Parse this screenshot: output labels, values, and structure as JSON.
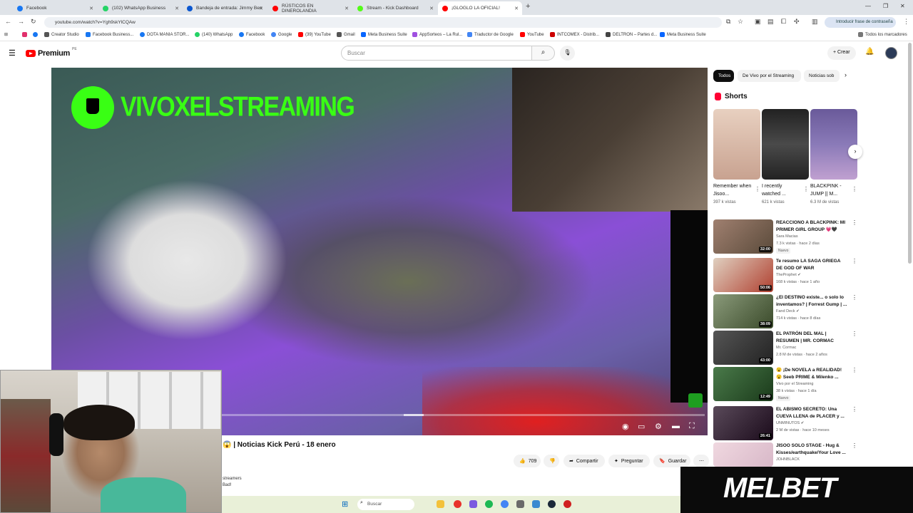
{
  "browser": {
    "tabs": [
      {
        "label": "Facebook",
        "color": "#1877f2"
      },
      {
        "label": "(102) WhatsApp Business",
        "color": "#25d366"
      },
      {
        "label": "Bandeja de entrada: Jimmy Ben",
        "color": "#0b57d0"
      },
      {
        "label": "RÚSTICOS EN DINEROLANDIA",
        "color": "#ff0000"
      },
      {
        "label": "Stream - Kick Dashboard",
        "color": "#53fc18"
      },
      {
        "label": "¡GLOGLO LA OFICIAL!",
        "color": "#ff0000"
      }
    ],
    "url": "youtube.com/watch?v=Ygh9skYlCQAw",
    "password_prompt": "Introducir frase de contraseña",
    "bookmarks": [
      "Creator Studio",
      "Facebook Business...",
      "DOTA MANIA STOR...",
      "(140) WhatsApp",
      "Facebook",
      "Google",
      "(39) YouTube",
      "Gmail",
      "Meta Business Suite",
      "AppSorteos – La Rul...",
      "Traductor de Google",
      "YouTube",
      "INTCOMEX - Distrib...",
      "DELTRON – Partes d...",
      "Meta Business Suite"
    ],
    "bookmarks_all": "Todos los marcadores"
  },
  "youtube": {
    "logo": "Premium",
    "logo_region": "PE",
    "search_placeholder": "Buscar",
    "create_label": "Crear"
  },
  "video": {
    "channel_overlay": "VIVOXELSTREAMING",
    "progress_fraction": 0.007,
    "title": "😱 | Noticias Kick Perú - 18 enero",
    "likes": "709",
    "share_label": "Compartir",
    "ask_label": "Preguntar",
    "save_label": "Guardar",
    "description_fragment_1": "streamers",
    "description_fragment_2": "Bad!"
  },
  "sidebar": {
    "chips": [
      "Todos",
      "De Vivo por el Streaming",
      "Noticias sob"
    ],
    "shorts_heading": "Shorts",
    "shorts": [
      {
        "title": "Remember when Jisoo...",
        "views": "397 k vistas",
        "color": "#c8a290"
      },
      {
        "title": "I recently watched ...",
        "views": "621 k vistas",
        "color": "#4a4a4a"
      },
      {
        "title": "BLACKPINK - JUMP || M...",
        "views": "6.3 M de vistas",
        "color": "#8a7ab8"
      }
    ],
    "recommendations": [
      {
        "title": "REACCIONO A BLACKPINK: MI PRIMER GIRL GROUP 💗🖤",
        "channel": "Sara Macias",
        "meta": "7.3 k vistas · hace 2 días",
        "duration": "32:00",
        "badge": "Nuevo",
        "color": "#7a6a5a"
      },
      {
        "title": "Te resumo LA SAGA GRIEGA DE GOD OF WAR",
        "channel": "TheProphet ✔",
        "meta": "168 k vistas · hace 1 año",
        "duration": "50:06",
        "badge": "",
        "color": "#b04030"
      },
      {
        "title": "¿El DESTINO existe... o solo lo inventamos? | Forrest Gump | ...",
        "channel": "Fand Deck ✔",
        "meta": "714 k vistas · hace 8 días",
        "duration": "38:09",
        "badge": "",
        "color": "#5a6a4a"
      },
      {
        "title": "EL PATRÓN DEL MAL | RESUMEN | MR. CORMAC",
        "channel": "Mr. Cormac",
        "meta": "2.8 M de vistas · hace 2 años",
        "duration": "43:00",
        "badge": "",
        "color": "#3a3a3a"
      },
      {
        "title": "😮 ¡De NOVELA a REALIDAD! 😮 Seeb PRIME & Milenko ...",
        "channel": "Vivo por el Streaming",
        "meta": "38 k vistas · hace 1 día",
        "duration": "12:49",
        "badge": "Nuevo",
        "color": "#2a5a2a"
      },
      {
        "title": "EL ABISMO SECRETO: Una CUEVA LLENA de PLACER y ...",
        "channel": "UNMINUTOS ✔",
        "meta": "2 M de vistas · hace 10 meses",
        "duration": "26:41",
        "badge": "",
        "color": "#3a2a3a"
      },
      {
        "title": "JISOO SOLO STAGE - Hug & Kisses/earthquake/Your Love ...",
        "channel": "JOHNBLACK",
        "meta": "",
        "duration": "",
        "badge": "",
        "color": "#d8b8c8"
      }
    ]
  },
  "taskbar": {
    "search_label": "Buscar"
  },
  "ad": {
    "brand": "MELBET"
  }
}
